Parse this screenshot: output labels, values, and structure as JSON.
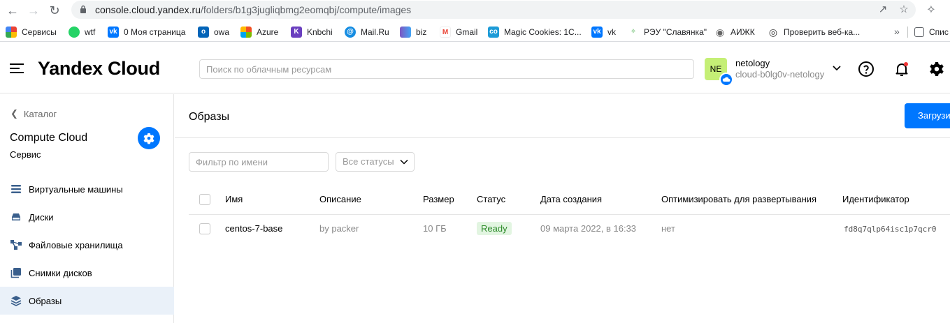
{
  "browser": {
    "url_host": "console.cloud.yandex.ru",
    "url_path": "/folders/b1g3jugliqbmg2eomqbj/compute/images",
    "bookmarks": [
      {
        "label": "Сервисы",
        "color": "#ea4335"
      },
      {
        "label": "wtf",
        "color": "#25d366"
      },
      {
        "label": "0 Моя страница",
        "color": "#0077ff"
      },
      {
        "label": "owa",
        "color": "#0364b8"
      },
      {
        "label": "Azure",
        "color": "#f25022"
      },
      {
        "label": "Knbchi",
        "color": "#6a3fbf"
      },
      {
        "label": "Mail.Ru",
        "color": "#168de2"
      },
      {
        "label": "biz",
        "color": "#7e57c2"
      },
      {
        "label": "Gmail",
        "color": "#ea4335"
      },
      {
        "label": "Magic Cookies: 1С...",
        "color": "#1d9bd7"
      },
      {
        "label": "vk",
        "color": "#0077ff"
      },
      {
        "label": "РЭУ \"Славянка\"",
        "color": "#4caf50"
      },
      {
        "label": "АИЖК",
        "color": "#666666"
      },
      {
        "label": "Проверить веб-ка...",
        "color": "#333333"
      }
    ],
    "bookmarks_more": "»",
    "reading_list": "Спис"
  },
  "header": {
    "logo": "Yandex Cloud",
    "search_placeholder": "Поиск по облачным ресурсам",
    "avatar_initials": "NE",
    "account_name": "netology",
    "cloud_name": "cloud-b0lg0v-netology"
  },
  "sidebar": {
    "back_label": "Каталог",
    "service_title": "Compute Cloud",
    "service_subtitle": "Сервис",
    "items": [
      {
        "label": "Виртуальные машины",
        "icon": "vm-icon"
      },
      {
        "label": "Диски",
        "icon": "disk-icon"
      },
      {
        "label": "Файловые хранилища",
        "icon": "file-storage-icon"
      },
      {
        "label": "Снимки дисков",
        "icon": "snapshot-icon"
      },
      {
        "label": "Образы",
        "icon": "images-icon",
        "active": true
      }
    ]
  },
  "main": {
    "title": "Образы",
    "primary_button": "Загрузить",
    "filter_placeholder": "Фильтр по имени",
    "status_filter": "Все статусы",
    "columns": [
      "Имя",
      "Описание",
      "Размер",
      "Статус",
      "Дата создания",
      "Оптимизировать для развертывания",
      "Идентификатор"
    ],
    "rows": [
      {
        "name": "centos-7-base",
        "description": "by packer",
        "size": "10 ГБ",
        "status": "Ready",
        "created": "09 марта 2022, в 16:33",
        "optimize": "нет",
        "id": "fd8q7qlp64isc1p7qcr0"
      }
    ]
  },
  "colors": {
    "accent": "#0077ff",
    "status_ready_bg": "#e2f5e1",
    "status_ready_text": "#2d8b2a",
    "active_nav_bg": "#eaf1f9"
  }
}
